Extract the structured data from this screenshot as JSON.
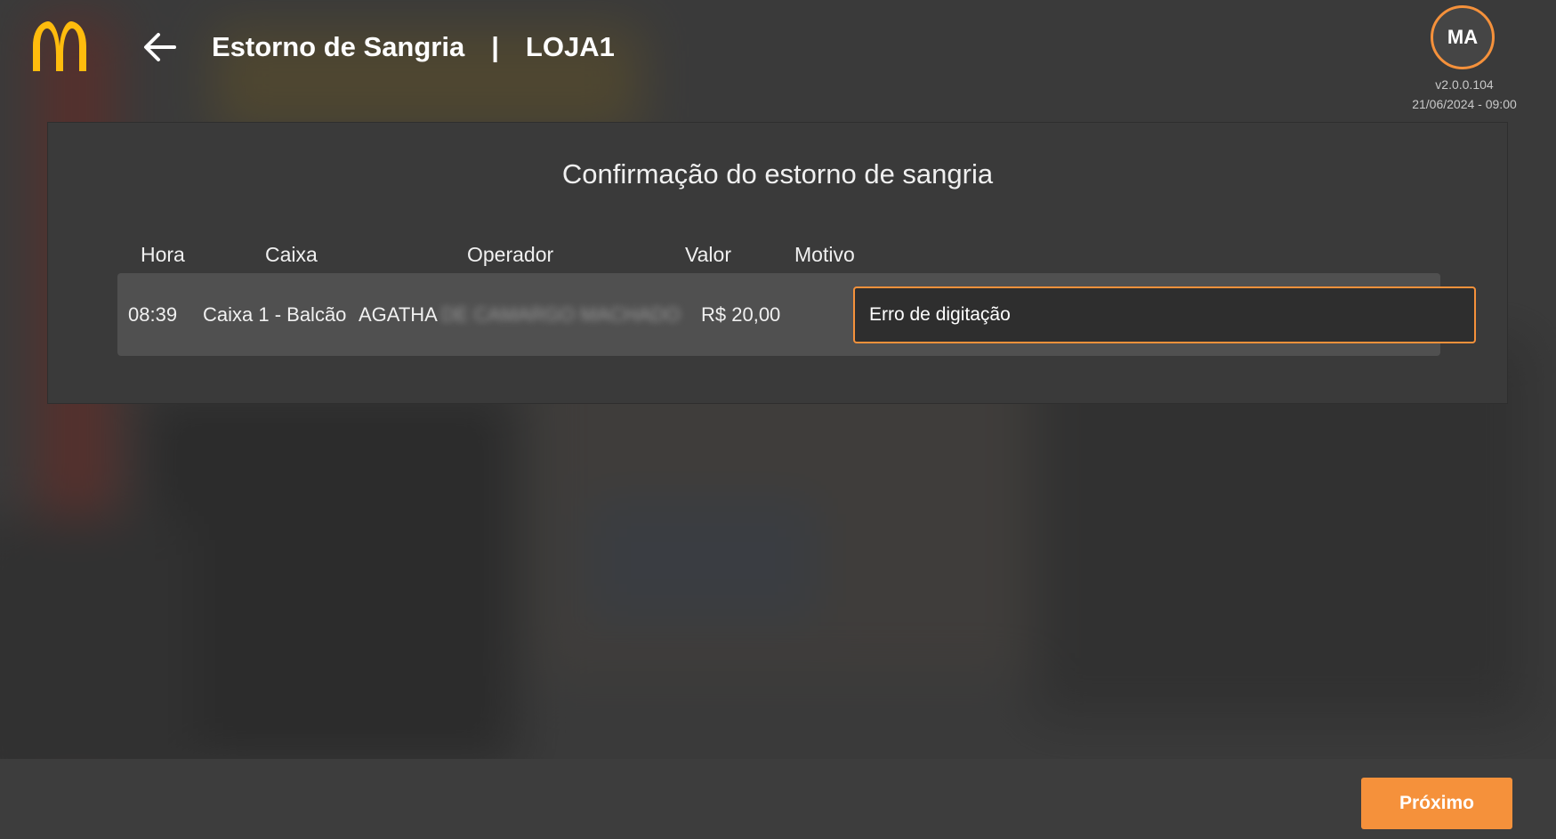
{
  "header": {
    "title": "Estorno de Sangria",
    "separator": "|",
    "store": "LOJA1",
    "back_icon": "arrow-left-icon",
    "logo_icon": "mcdonalds-arches-icon",
    "avatar_initials": "MA",
    "version": "v2.0.0.104",
    "datetime": "21/06/2024 - 09:00"
  },
  "panel": {
    "title": "Confirmação do estorno de sangria",
    "columns": {
      "hora": "Hora",
      "caixa": "Caixa",
      "operador": "Operador",
      "valor": "Valor",
      "motivo": "Motivo"
    },
    "row": {
      "hora": "08:39",
      "caixa": "Caixa 1 - Balcão",
      "operador": "AGATHA",
      "operador_hidden": "DE CAMARGO MACHADO",
      "valor": "R$ 20,00",
      "motivo": "Erro de digitação"
    }
  },
  "footer": {
    "next_label": "Próximo"
  },
  "colors": {
    "accent": "#f5913b",
    "logo_yellow": "#ffbc0d",
    "background": "#3f3f3f",
    "panel": "#3a3a3a",
    "row": "#505050"
  }
}
